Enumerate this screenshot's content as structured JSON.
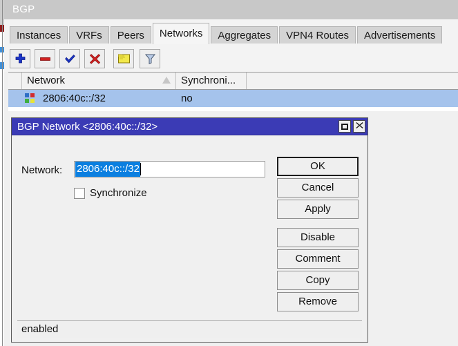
{
  "window": {
    "title": "BGP",
    "tabs": [
      {
        "label": "Instances",
        "active": false
      },
      {
        "label": "VRFs",
        "active": false
      },
      {
        "label": "Peers",
        "active": false
      },
      {
        "label": "Networks",
        "active": true
      },
      {
        "label": "Aggregates",
        "active": false
      },
      {
        "label": "VPN4 Routes",
        "active": false
      },
      {
        "label": "Advertisements",
        "active": false
      }
    ],
    "toolbar": [
      {
        "name": "add-button",
        "icon": "plus-icon",
        "color": "#1b35c8"
      },
      {
        "name": "remove-button",
        "icon": "minus-icon",
        "color": "#d02020"
      },
      {
        "name": "enable-button",
        "icon": "check-icon",
        "color": "#1b35c8"
      },
      {
        "name": "disable-button",
        "icon": "cross-icon",
        "color": "#d02020"
      },
      {
        "name": "comment-button",
        "icon": "note-icon",
        "color": "#e8d93a"
      },
      {
        "name": "filter-button",
        "icon": "funnel-icon",
        "color": "#b9cbe6"
      }
    ]
  },
  "table": {
    "columns": [
      "Network",
      "Synchroni..."
    ],
    "sort_column": "Network",
    "sort_direction": "ascending",
    "rows": [
      {
        "network": "2806:40c::/32",
        "synchronize": "no",
        "selected": true
      }
    ]
  },
  "dialog": {
    "title": "BGP Network <2806:40c::/32>",
    "titlebar_color": "#3b3bb5",
    "network_label": "Network:",
    "network_value": "2806:40c::/32",
    "network_value_selected": true,
    "synchronize_label": "Synchronize",
    "synchronize_checked": false,
    "buttons": [
      {
        "label": "OK",
        "default": true
      },
      {
        "label": "Cancel",
        "default": false
      },
      {
        "label": "Apply",
        "default": false
      },
      {
        "label": "Disable",
        "default": false
      },
      {
        "label": "Comment",
        "default": false
      },
      {
        "label": "Copy",
        "default": false
      },
      {
        "label": "Remove",
        "default": false
      }
    ],
    "status": "enabled",
    "title_buttons": {
      "maximize": "maximize-icon",
      "close": "close-icon"
    }
  },
  "colors": {
    "selection_blue": "#0b7fe0",
    "row_selected": "#a5c3ec",
    "dialog_title": "#3b3bb5",
    "window_title_bar": "#c8c8c8"
  }
}
